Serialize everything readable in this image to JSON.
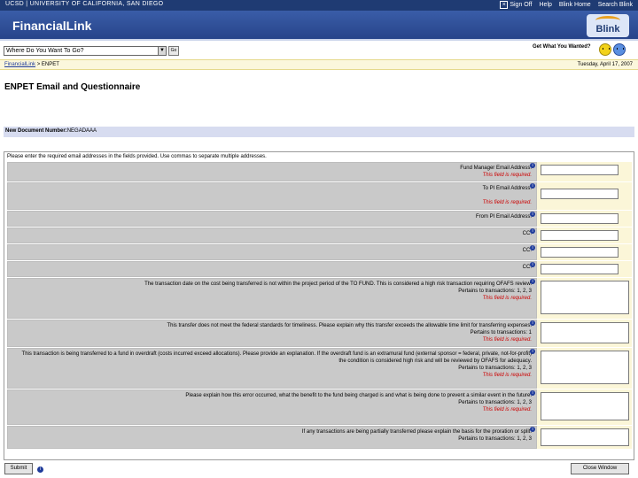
{
  "topbar": {
    "left_text": "UCSD | UNIVERSITY OF CALIFORNIA, SAN DIEGO",
    "signoff": "Sign Off",
    "help": "Help",
    "blink_home": "Blink Home",
    "search_blink": "Search Blink"
  },
  "app": {
    "title": "FinancialLink",
    "logo_text": "Blink"
  },
  "nav": {
    "where_select": "Where Do You Want To Go?",
    "go": "Go",
    "got_what_you_wanted": "Get What You Wanted?"
  },
  "breadcrumb": {
    "home": "FinancialLink",
    "separator": " > ",
    "current": "ENPET"
  },
  "date": "Tuesday, April 17, 2007",
  "page_title": "ENPET Email and Questionnaire",
  "document": {
    "label": "New Document Number:",
    "value": "NEGADAAA"
  },
  "form": {
    "instructions": "Please enter the required email addresses in the fields provided. Use commas to separate multiple addresses.",
    "rows": [
      {
        "label": "Fund Manager Email Address:",
        "required": "This field is required."
      },
      {
        "label": "To PI Email Address:",
        "required": "This field is required."
      },
      {
        "label": "From PI Email Address:",
        "required": ""
      },
      {
        "label": "CC:",
        "required": ""
      },
      {
        "label": "CC:",
        "required": ""
      },
      {
        "label": "CC:",
        "required": ""
      },
      {
        "label": "The transaction date on the cost being transferred is not within the project period of the TO FUND. This is considered a high risk transaction requiring OFAFS review.",
        "pertains": "Pertains to transactions: 1, 2, 3",
        "required": "This field is required."
      },
      {
        "label": "This transfer does not meet the federal standards for timeliness. Please explain why this transfer exceeds the allowable time limit for transferring expenses.",
        "pertains": "Pertains to transactions: 1",
        "required": "This field is required."
      },
      {
        "label": "This transaction is being transferred to a fund in overdraft (costs incurred exceed allocations). Please provide an explanation. If the overdraft fund is an extramural fund (external sponsor = federal, private, not-for-profit) the condition is considered high risk and will be reviewed by OFAFS for adequacy.",
        "pertains": "Pertains to transactions: 1, 2, 3",
        "required": "This field is required."
      },
      {
        "label": "Please explain how this error occurred, what the benefit to the fund being charged is and what is being done to prevent a similar event in the future.",
        "pertains": "Pertains to transactions: 1, 2, 3",
        "required": "This field is required."
      },
      {
        "label": "If any transactions are being partially transferred please explain the basis for the proration or split.",
        "pertains": "Pertains to transactions: 1, 2, 3",
        "required": ""
      }
    ]
  },
  "buttons": {
    "submit": "Submit",
    "close": "Close Window"
  },
  "colors": {
    "brand_blue": "#27448a",
    "label_gray": "#c9c9c9",
    "field_yellow": "#fbf6d8",
    "required_red": "#cc0000"
  }
}
